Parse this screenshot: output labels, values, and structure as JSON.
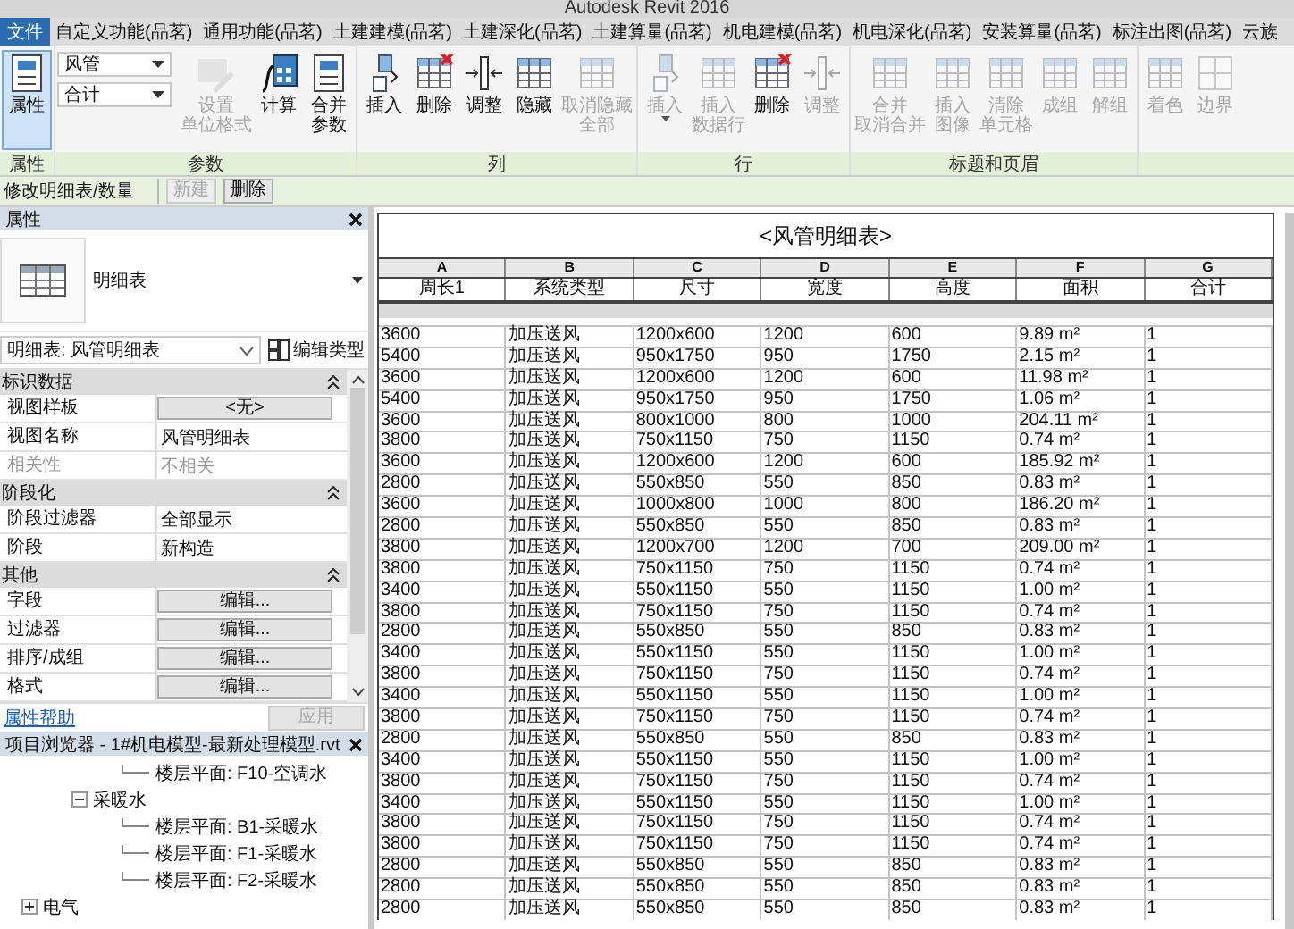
{
  "window": {
    "title": "Autodesk Revit 2016"
  },
  "tabs": [
    {
      "label": "文件",
      "kind": "application"
    },
    {
      "label": "自定义功能(品茗)",
      "kind": "tab"
    },
    {
      "label": "通用功能(品茗)",
      "kind": "tab"
    },
    {
      "label": "土建建模(品茗)",
      "kind": "tab"
    },
    {
      "label": "土建深化(品茗)",
      "kind": "tab"
    },
    {
      "label": "土建算量(品茗)",
      "kind": "tab"
    },
    {
      "label": "机电建模(品茗)",
      "kind": "tab"
    },
    {
      "label": "机电深化(品茗)",
      "kind": "tab"
    },
    {
      "label": "安装算量(品茗)",
      "kind": "tab"
    },
    {
      "label": "标注出图(品茗)",
      "kind": "tab"
    },
    {
      "label": "云族",
      "kind": "tab"
    }
  ],
  "ribbon": {
    "panels": [
      {
        "label": "属性",
        "buttons": [
          {
            "lines": [
              "属性"
            ],
            "active": true,
            "disabled": false
          }
        ]
      },
      {
        "label": "参数",
        "combos": [
          "风管",
          "合计"
        ],
        "buttons": [
          {
            "lines": [
              "设置",
              "单位格式"
            ],
            "active": false,
            "disabled": true
          },
          {
            "lines": [
              "计算"
            ],
            "active": false,
            "disabled": false
          },
          {
            "lines": [
              "合并",
              "参数"
            ],
            "active": false,
            "disabled": false
          }
        ]
      },
      {
        "label": "列",
        "buttons": [
          {
            "lines": [
              "插入"
            ],
            "active": false,
            "disabled": false
          },
          {
            "lines": [
              "删除"
            ],
            "active": false,
            "disabled": false
          },
          {
            "lines": [
              "调整"
            ],
            "active": false,
            "disabled": false
          },
          {
            "lines": [
              "隐藏"
            ],
            "active": false,
            "disabled": false
          },
          {
            "lines": [
              "取消隐藏",
              "全部"
            ],
            "active": false,
            "disabled": true
          }
        ]
      },
      {
        "label": "行",
        "buttons": [
          {
            "lines": [
              "插入"
            ],
            "active": false,
            "disabled": true,
            "menu": true
          },
          {
            "lines": [
              "插入",
              "数据行"
            ],
            "active": false,
            "disabled": true
          },
          {
            "lines": [
              "删除"
            ],
            "active": false,
            "disabled": false
          },
          {
            "lines": [
              "调整"
            ],
            "active": false,
            "disabled": true
          }
        ]
      },
      {
        "label": "标题和页眉",
        "buttons": [
          {
            "lines": [
              "合并",
              "取消合并"
            ],
            "active": false,
            "disabled": true
          },
          {
            "lines": [
              "插入",
              "图像"
            ],
            "active": false,
            "disabled": true
          },
          {
            "lines": [
              "清除",
              "单元格"
            ],
            "active": false,
            "disabled": true
          },
          {
            "lines": [
              "成组"
            ],
            "active": false,
            "disabled": true
          },
          {
            "lines": [
              "解组"
            ],
            "active": false,
            "disabled": true
          }
        ]
      },
      {
        "buttons": [
          {
            "lines": [
              "着色"
            ],
            "active": false,
            "disabled": true
          },
          {
            "lines": [
              "边界"
            ],
            "active": false,
            "disabled": true
          }
        ]
      }
    ]
  },
  "context_bar": {
    "label": "修改明细表/数量",
    "buttons": [
      {
        "label": "新建",
        "disabled": true
      },
      {
        "label": "删除",
        "disabled": false
      }
    ]
  },
  "properties": {
    "title": "属性",
    "type_name": "明细表",
    "type_selector": "明细表: 风管明细表",
    "edit_type": "编辑类型",
    "groups": [
      {
        "label": "标识数据",
        "expanded": true,
        "rows": [
          {
            "label": "视图样板",
            "value": "<无>",
            "kind": "button",
            "disabled": false
          },
          {
            "label": "视图名称",
            "value": "风管明细表",
            "kind": "value",
            "disabled": false
          },
          {
            "label": "相关性",
            "value": "不相关",
            "kind": "value",
            "disabled": true
          }
        ]
      },
      {
        "label": "阶段化",
        "expanded": true,
        "rows": [
          {
            "label": "阶段过滤器",
            "value": "全部显示",
            "kind": "value",
            "disabled": false
          },
          {
            "label": "阶段",
            "value": "新构造",
            "kind": "value",
            "disabled": false
          }
        ]
      },
      {
        "label": "其他",
        "expanded": true,
        "rows": [
          {
            "label": "字段",
            "value": "编辑...",
            "kind": "button",
            "disabled": false
          },
          {
            "label": "过滤器",
            "value": "编辑...",
            "kind": "button",
            "disabled": false
          },
          {
            "label": "排序/成组",
            "value": "编辑...",
            "kind": "button",
            "disabled": false
          },
          {
            "label": "格式",
            "value": "编辑...",
            "kind": "button",
            "disabled": false
          }
        ]
      }
    ],
    "help_link": "属性帮助",
    "apply": {
      "label": "应用",
      "disabled": true
    }
  },
  "project_browser": {
    "title": "项目浏览器 - 1#机电模型-最新处理模型.rvt",
    "tree": [
      {
        "children": [
          {
            "children": [
              {
                "label": "楼层平面: F10-空调水"
              }
            ]
          },
          {
            "label": "采暖水",
            "expanded": true,
            "children": [
              {
                "label": "楼层平面: B1-采暖水"
              },
              {
                "label": "楼层平面: F1-采暖水"
              },
              {
                "label": "楼层平面: F2-采暖水"
              }
            ]
          }
        ]
      },
      {
        "label": "电气",
        "expanded": false
      }
    ]
  },
  "schedule": {
    "title": "<风管明细表>",
    "column_letters": [
      "A",
      "B",
      "C",
      "D",
      "E",
      "F",
      "G"
    ],
    "columns": [
      "周长1",
      "系统类型",
      "尺寸",
      "宽度",
      "高度",
      "面积",
      "合计"
    ],
    "rows": [
      [
        "3600",
        "加压送风",
        "1200x600",
        "1200",
        "600",
        "9.89 m²",
        "1"
      ],
      [
        "5400",
        "加压送风",
        "950x1750",
        "950",
        "1750",
        "2.15 m²",
        "1"
      ],
      [
        "3600",
        "加压送风",
        "1200x600",
        "1200",
        "600",
        "11.98 m²",
        "1"
      ],
      [
        "5400",
        "加压送风",
        "950x1750",
        "950",
        "1750",
        "1.06 m²",
        "1"
      ],
      [
        "3600",
        "加压送风",
        "800x1000",
        "800",
        "1000",
        "204.11 m²",
        "1"
      ],
      [
        "3800",
        "加压送风",
        "750x1150",
        "750",
        "1150",
        "0.74 m²",
        "1"
      ],
      [
        "3600",
        "加压送风",
        "1200x600",
        "1200",
        "600",
        "185.92 m²",
        "1"
      ],
      [
        "2800",
        "加压送风",
        "550x850",
        "550",
        "850",
        "0.83 m²",
        "1"
      ],
      [
        "3600",
        "加压送风",
        "1000x800",
        "1000",
        "800",
        "186.20 m²",
        "1"
      ],
      [
        "2800",
        "加压送风",
        "550x850",
        "550",
        "850",
        "0.83 m²",
        "1"
      ],
      [
        "3800",
        "加压送风",
        "1200x700",
        "1200",
        "700",
        "209.00 m²",
        "1"
      ],
      [
        "3800",
        "加压送风",
        "750x1150",
        "750",
        "1150",
        "0.74 m²",
        "1"
      ],
      [
        "3400",
        "加压送风",
        "550x1150",
        "550",
        "1150",
        "1.00 m²",
        "1"
      ],
      [
        "3800",
        "加压送风",
        "750x1150",
        "750",
        "1150",
        "0.74 m²",
        "1"
      ],
      [
        "2800",
        "加压送风",
        "550x850",
        "550",
        "850",
        "0.83 m²",
        "1"
      ],
      [
        "3400",
        "加压送风",
        "550x1150",
        "550",
        "1150",
        "1.00 m²",
        "1"
      ],
      [
        "3800",
        "加压送风",
        "750x1150",
        "750",
        "1150",
        "0.74 m²",
        "1"
      ],
      [
        "3400",
        "加压送风",
        "550x1150",
        "550",
        "1150",
        "1.00 m²",
        "1"
      ],
      [
        "3800",
        "加压送风",
        "750x1150",
        "750",
        "1150",
        "0.74 m²",
        "1"
      ],
      [
        "2800",
        "加压送风",
        "550x850",
        "550",
        "850",
        "0.83 m²",
        "1"
      ],
      [
        "3400",
        "加压送风",
        "550x1150",
        "550",
        "1150",
        "1.00 m²",
        "1"
      ],
      [
        "3800",
        "加压送风",
        "750x1150",
        "750",
        "1150",
        "0.74 m²",
        "1"
      ],
      [
        "3400",
        "加压送风",
        "550x1150",
        "550",
        "1150",
        "1.00 m²",
        "1"
      ],
      [
        "3800",
        "加压送风",
        "750x1150",
        "750",
        "1150",
        "0.74 m²",
        "1"
      ],
      [
        "3800",
        "加压送风",
        "750x1150",
        "750",
        "1150",
        "0.74 m²",
        "1"
      ],
      [
        "2800",
        "加压送风",
        "550x850",
        "550",
        "850",
        "0.83 m²",
        "1"
      ],
      [
        "2800",
        "加压送风",
        "550x850",
        "550",
        "850",
        "0.83 m²",
        "1"
      ],
      [
        "2800",
        "加压送风",
        "550x850",
        "550",
        "850",
        "0.83 m²",
        "1"
      ]
    ]
  }
}
